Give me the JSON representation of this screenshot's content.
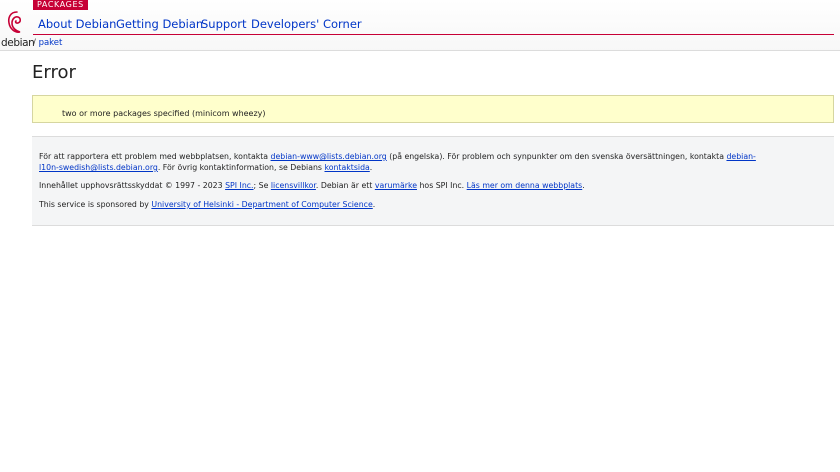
{
  "header": {
    "logo_text": "debian",
    "section_badge": "PACKAGES",
    "nav": [
      {
        "label": "About Debian"
      },
      {
        "label": "Getting Debian"
      },
      {
        "label": "Support"
      },
      {
        "label": "Developers' Corner"
      }
    ],
    "breadcrumb": {
      "separator": "/",
      "item": "paket"
    }
  },
  "main": {
    "title": "Error",
    "error_message": "two or more packages specified (minicom wheezy)"
  },
  "footer": {
    "p1": {
      "t1": "För att rapportera ett problem med webbplatsen, kontakta ",
      "link1": "debian-www@lists.debian.org",
      "t2": " (på engelska). För problem och synpunkter om den svenska översättningen, kontakta ",
      "link2": "debian-l10n-swedish@lists.debian.org",
      "t3": ". För övrig kontaktinformation, se Debians ",
      "link3": "kontaktsida",
      "t4": "."
    },
    "p2": {
      "t1": "Innehållet upphovsrättsskyddat © 1997 - 2023 ",
      "link1": "SPI Inc.",
      "t2": "; Se ",
      "link2": "licensvillkor",
      "t3": ". Debian är ett ",
      "link3": "varumärke",
      "t4": " hos SPI Inc. ",
      "link4": "Läs mer om denna webbplats",
      "t5": "."
    },
    "p3": {
      "t1": "This service is sponsored by ",
      "link1": "University of Helsinki - Department of Computer Science",
      "t2": "."
    }
  },
  "colors": {
    "brand_red": "#c70036",
    "link_blue": "#0035c7",
    "error_bg": "#ffffcc",
    "footer_bg": "#f4f5f6"
  }
}
